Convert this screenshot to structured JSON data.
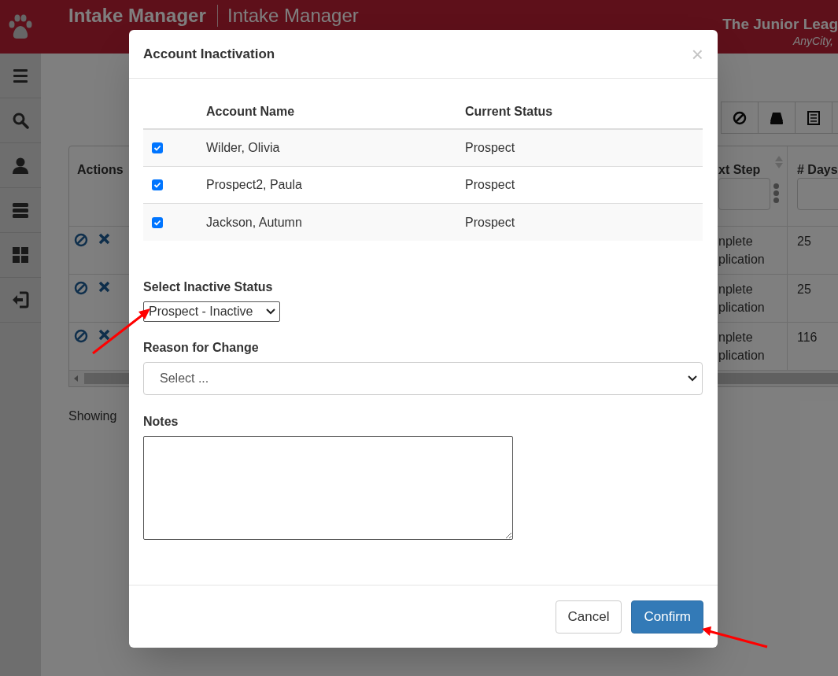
{
  "app": {
    "title": "Intake Manager",
    "subtitle": "Intake Manager",
    "org": "The Junior Leag",
    "city": "AnyCity,"
  },
  "background_table": {
    "columns": [
      "Actions",
      "xt Step",
      "# Days"
    ],
    "rows": [
      {
        "next_step": "nplete",
        "next_step_2": "plication",
        "days": "25"
      },
      {
        "next_step": "nplete",
        "next_step_2": "plication",
        "days": "25"
      },
      {
        "next_step": "nplete",
        "next_step_2": "plication",
        "days": "116"
      }
    ],
    "footer_text": "Showing"
  },
  "modal": {
    "title": "Account Inactivation",
    "close": "×",
    "table": {
      "columns": [
        "Account Name",
        "Current Status"
      ],
      "rows": [
        {
          "checked": true,
          "name": "Wilder, Olivia",
          "status": "Prospect"
        },
        {
          "checked": true,
          "name": "Prospect2, Paula",
          "status": "Prospect"
        },
        {
          "checked": true,
          "name": "Jackson, Autumn",
          "status": "Prospect"
        }
      ]
    },
    "status_label": "Select Inactive Status",
    "status_value": "Prospect - Inactive",
    "reason_label": "Reason for Change",
    "reason_placeholder": "Select ...",
    "notes_label": "Notes",
    "buttons": [
      {
        "label": "Cancel",
        "kind": "default"
      },
      {
        "label": "Confirm",
        "kind": "primary"
      }
    ]
  }
}
